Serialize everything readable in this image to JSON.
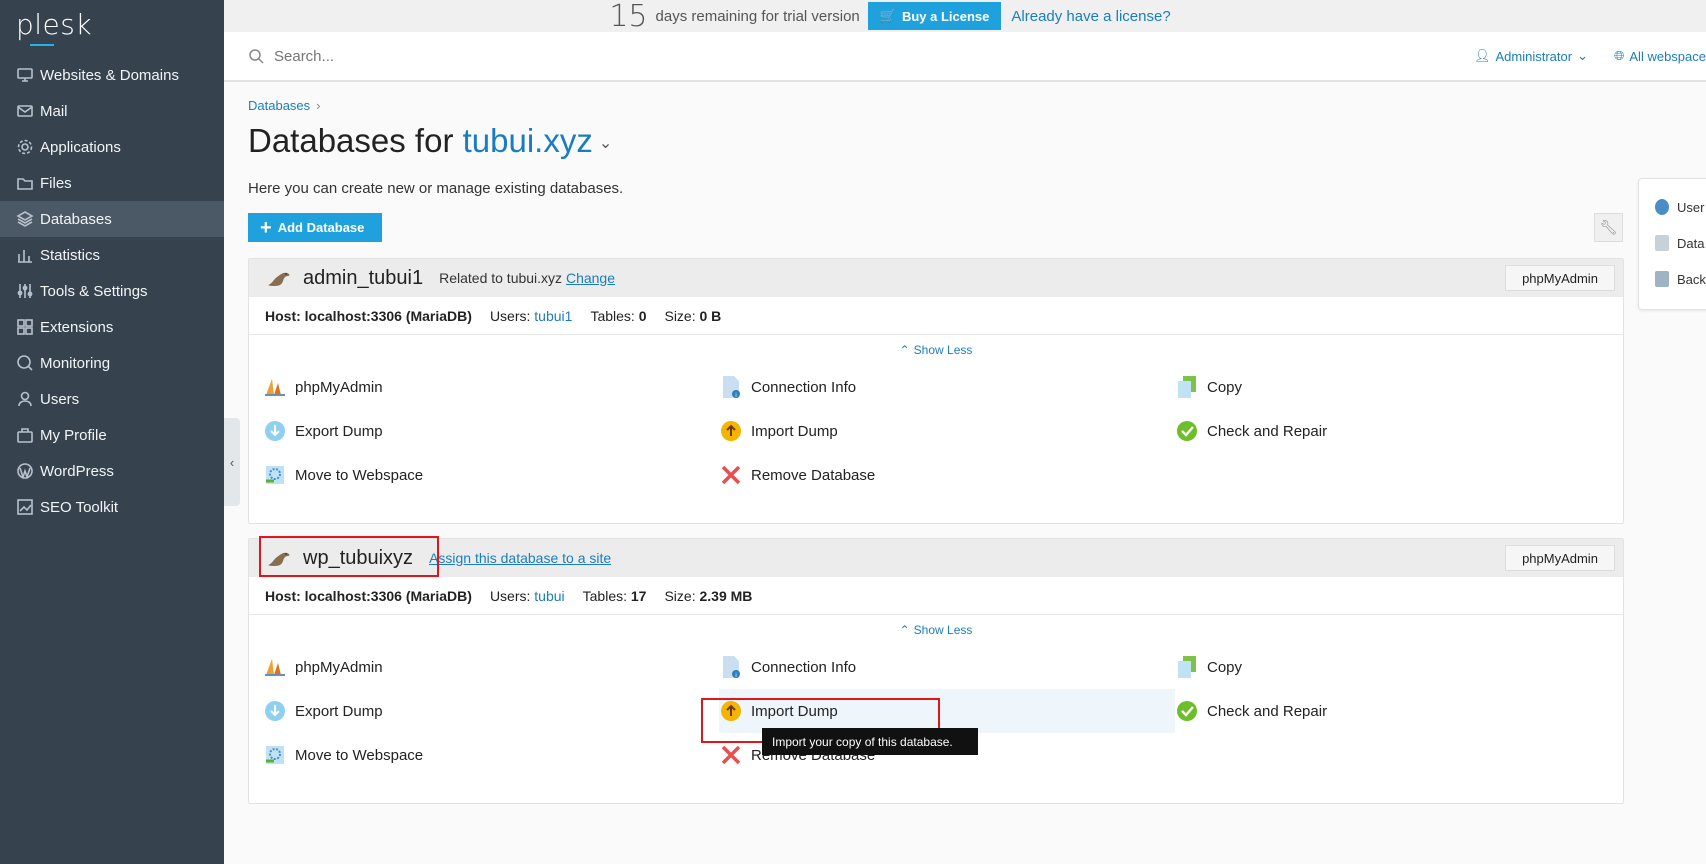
{
  "brand": {
    "logo": "plesk"
  },
  "sidebar": {
    "items": [
      {
        "label": "Websites & Domains",
        "icon": "monitor-icon"
      },
      {
        "label": "Mail",
        "icon": "mail-icon"
      },
      {
        "label": "Applications",
        "icon": "gear-icon"
      },
      {
        "label": "Files",
        "icon": "folder-icon"
      },
      {
        "label": "Databases",
        "icon": "layers-icon",
        "active": true
      },
      {
        "label": "Statistics",
        "icon": "bar-chart-icon"
      },
      {
        "label": "Tools & Settings",
        "icon": "sliders-icon"
      },
      {
        "label": "Extensions",
        "icon": "grid-icon"
      },
      {
        "label": "Monitoring",
        "icon": "monitor-search-icon"
      },
      {
        "label": "Users",
        "icon": "user-icon"
      },
      {
        "label": "My Profile",
        "icon": "briefcase-icon"
      },
      {
        "label": "WordPress",
        "icon": "wordpress-icon"
      },
      {
        "label": "SEO Toolkit",
        "icon": "chart-up-icon"
      }
    ]
  },
  "trial": {
    "days": "15",
    "text": "days remaining for trial version",
    "buy_label": "Buy a License",
    "license_link": "Already have a license?"
  },
  "header": {
    "search_placeholder": "Search...",
    "user": "Administrator",
    "webspace": "All webspace"
  },
  "breadcrumb": {
    "item": "Databases"
  },
  "page": {
    "title_prefix": "Databases for ",
    "title_domain": "tubui.xyz",
    "description": "Here you can create new or manage existing databases.",
    "add_button": "Add Database"
  },
  "right_panel": {
    "items": [
      "User",
      "Data",
      "Back"
    ]
  },
  "databases": [
    {
      "name": "admin_tubui1",
      "related_text": "Related to tubui.xyz",
      "related_link": "Change",
      "pma_button": "phpMyAdmin",
      "host": "Host: localhost:3306 (MariaDB)",
      "users_label": "Users:",
      "users_value": "tubui1",
      "tables_label": "Tables:",
      "tables_value": "0",
      "size_label": "Size:",
      "size_value": "0 B",
      "show_less": "Show Less",
      "tools": [
        "phpMyAdmin",
        "Connection Info",
        "Copy",
        "Export Dump",
        "Import Dump",
        "Check and Repair",
        "Move to Webspace",
        "Remove Database"
      ]
    },
    {
      "name": "wp_tubuixyz",
      "assign_link": "Assign this database to a site",
      "pma_button": "phpMyAdmin",
      "host": "Host: localhost:3306 (MariaDB)",
      "users_label": "Users:",
      "users_value": "tubui",
      "tables_label": "Tables:",
      "tables_value": "17",
      "size_label": "Size:",
      "size_value": "2.39 MB",
      "show_less": "Show Less",
      "tools": [
        "phpMyAdmin",
        "Connection Info",
        "Copy",
        "Export Dump",
        "Import Dump",
        "Check and Repair",
        "Move to Webspace",
        "Remove Database"
      ]
    }
  ],
  "tooltip": "Import your copy of this database.",
  "colors": {
    "sidebar": "#36434f",
    "accent": "#1fa1dd",
    "link": "#1a7dbf",
    "highlight": "#e0161b"
  }
}
